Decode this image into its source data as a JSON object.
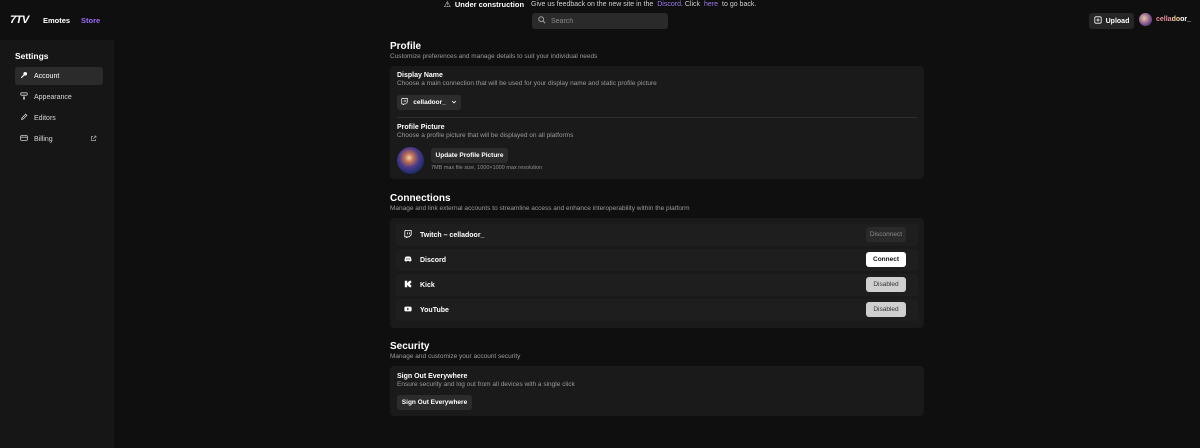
{
  "banner": {
    "title": "Under construction",
    "text_before": "Give us feedback on the new site in the",
    "discord_link": "Discord",
    "text_middle": ". Click",
    "here_link": "here",
    "text_after": "to go back."
  },
  "header": {
    "logo": "7TV",
    "nav": {
      "emotes": "Emotes",
      "store": "Store"
    },
    "search": {
      "placeholder": "Search"
    },
    "upload_label": "Upload",
    "username": {
      "part1": "cella",
      "part2": "do",
      "part3": "or_"
    }
  },
  "sidebar": {
    "title": "Settings",
    "items": [
      {
        "label": "Account",
        "icon": "key-icon",
        "active": true
      },
      {
        "label": "Appearance",
        "icon": "paint-roller-icon",
        "active": false
      },
      {
        "label": "Editors",
        "icon": "pencil-icon",
        "active": false
      },
      {
        "label": "Billing",
        "icon": "credit-card-icon",
        "active": false,
        "external": true
      }
    ]
  },
  "profile": {
    "title": "Profile",
    "subtitle": "Customize preferences and manage details to suit your individual needs",
    "display_name": {
      "label": "Display Name",
      "description": "Choose a main connection that will be used for your display name and static profile picture",
      "selected": "celladoor_"
    },
    "profile_picture": {
      "label": "Profile Picture",
      "description": "Choose a profile picture that will be displayed on all platforms",
      "button": "Update Profile Picture",
      "hint": "7MB max file size, 1000×1000 max resolution"
    }
  },
  "connections": {
    "title": "Connections",
    "subtitle": "Manage and link external accounts to streamline access and enhance interoperability within the platform",
    "items": [
      {
        "name": "Twitch – celladoor_",
        "icon": "twitch-icon",
        "action": "Disconnect",
        "state": "disconnect"
      },
      {
        "name": "Discord",
        "icon": "discord-icon",
        "action": "Connect",
        "state": "connect"
      },
      {
        "name": "Kick",
        "icon": "kick-icon",
        "action": "Disabled",
        "state": "disabled"
      },
      {
        "name": "YouTube",
        "icon": "youtube-icon",
        "action": "Disabled",
        "state": "disabled"
      }
    ]
  },
  "security": {
    "title": "Security",
    "subtitle": "Manage and customize your account security",
    "sign_out": {
      "label": "Sign Out Everywhere",
      "description": "Ensure security and log out from all devices with a single click",
      "button": "Sign Out Everywhere"
    }
  },
  "colors": {
    "background": "#0f0f0f",
    "card": "#1a1a1a",
    "accent_store": "#9b6cf7",
    "link": "#9a7cf0"
  }
}
